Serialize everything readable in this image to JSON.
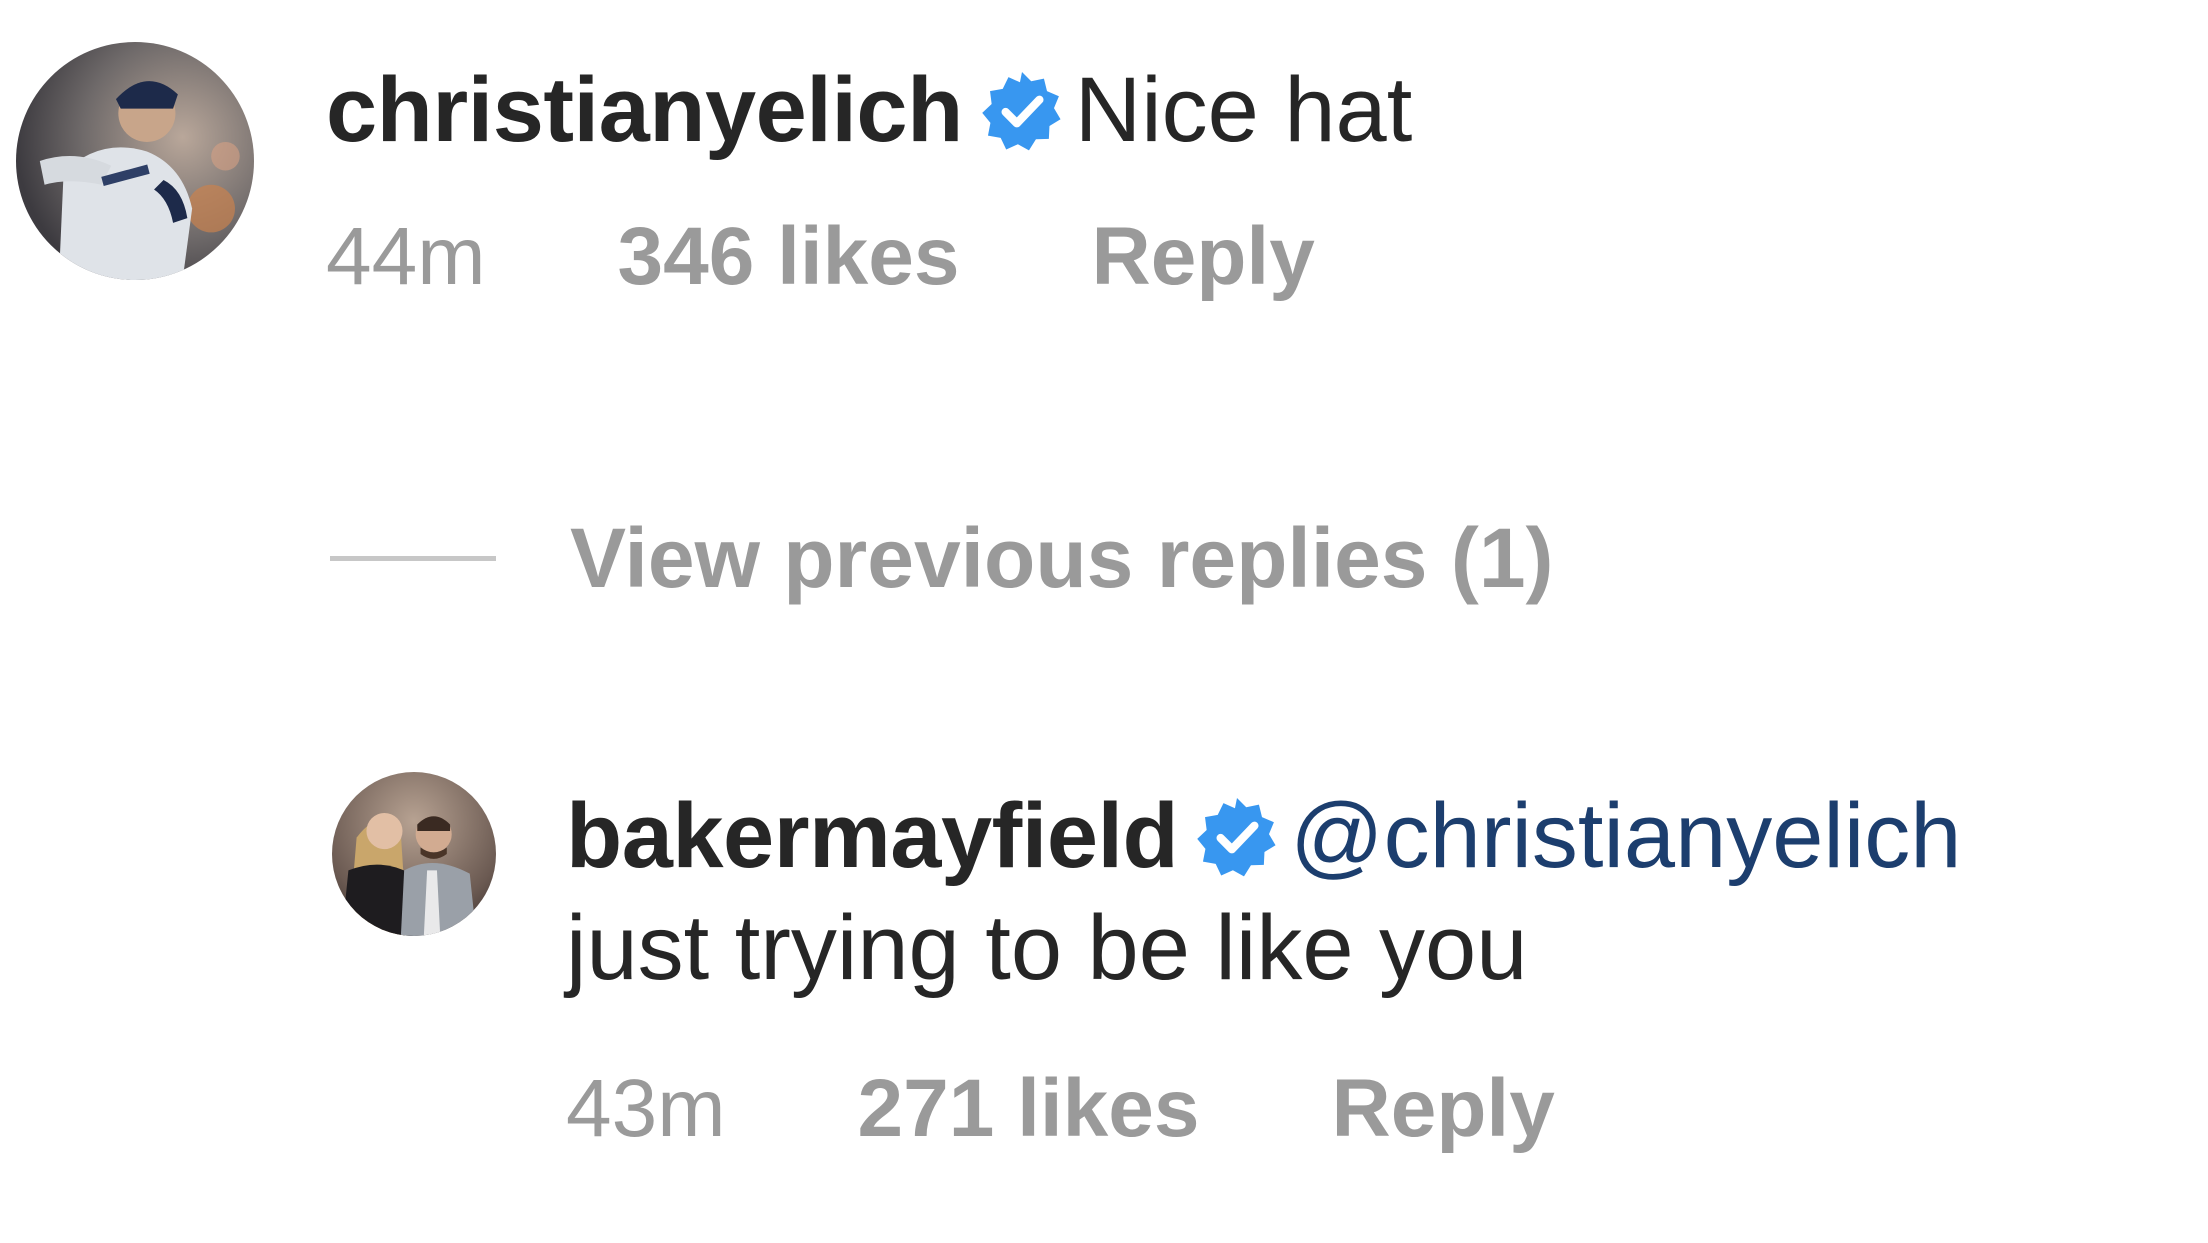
{
  "comments": [
    {
      "username": "christianyelich",
      "verified_icon": "verified-badge-icon",
      "text": "Nice hat",
      "time": "44m",
      "likes": "346 likes",
      "reply_label": "Reply"
    },
    {
      "username": "bakermayfield",
      "verified_icon": "verified-badge-icon",
      "mention": "@christianyelich",
      "text": "just trying to be like you",
      "time": "43m",
      "likes": "271 likes",
      "reply_label": "Reply"
    }
  ],
  "view_replies_label": "View previous replies (1)",
  "colors": {
    "verified": "#3897f0",
    "meta": "#9a9a9a",
    "text": "#262626",
    "mention": "#1c3e6e"
  }
}
